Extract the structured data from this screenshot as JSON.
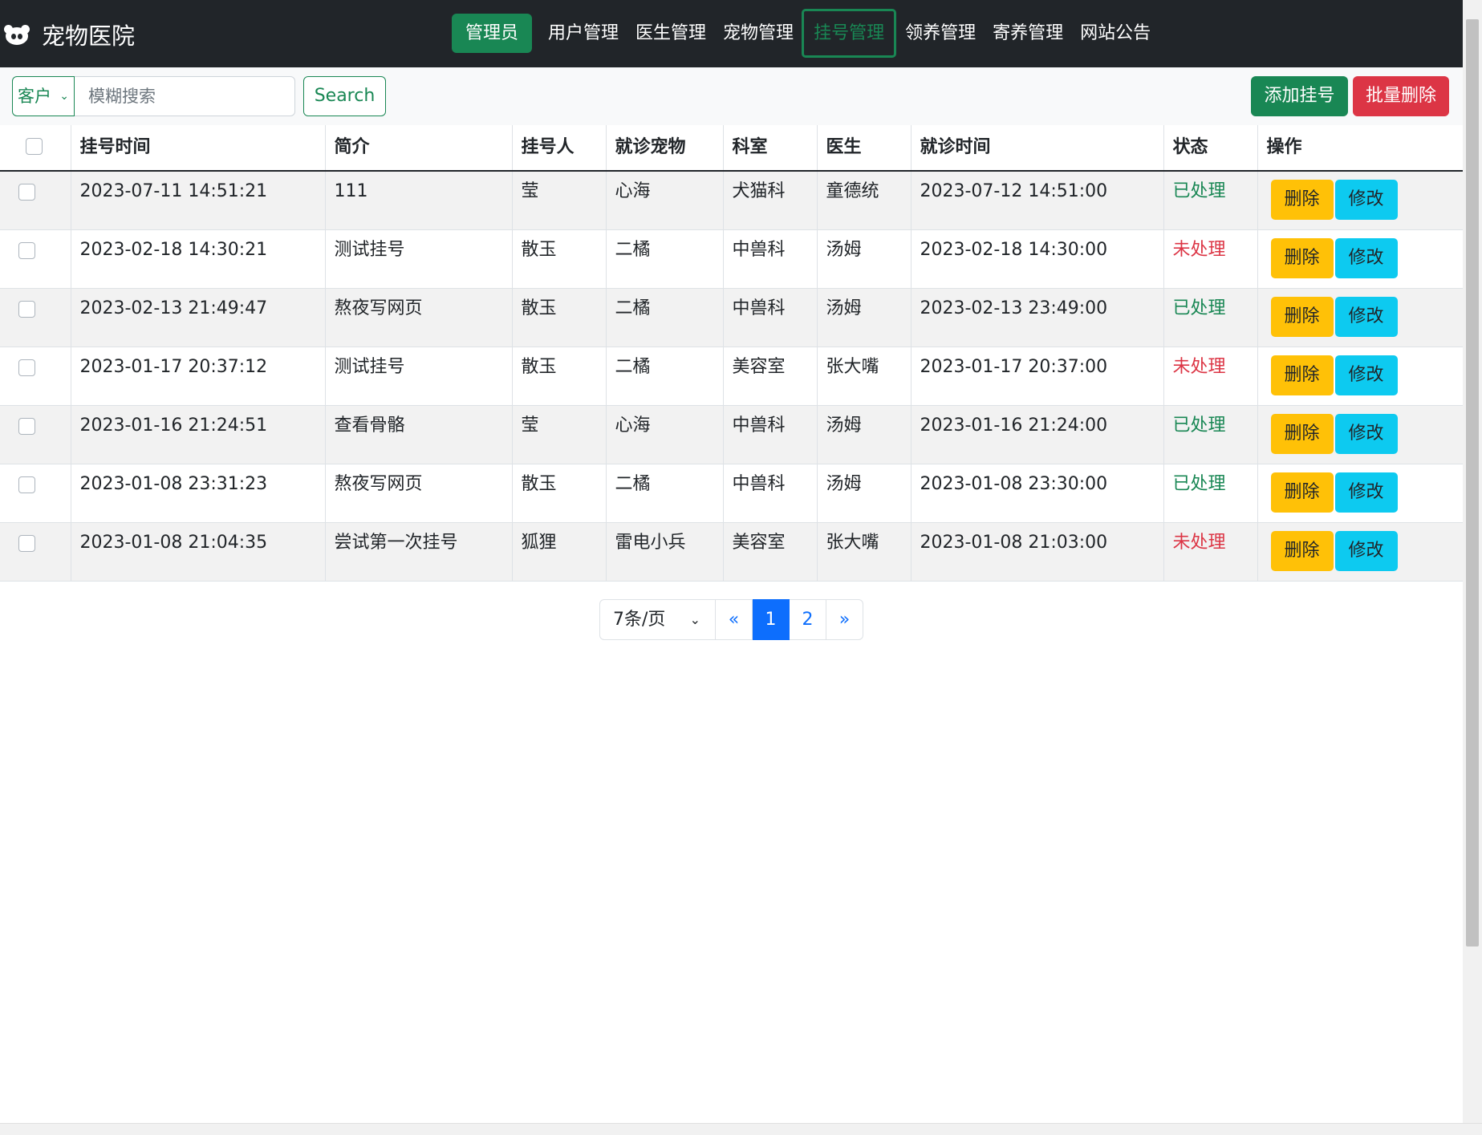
{
  "brand": {
    "title": "宠物医院",
    "logo_icon": "panda-icon"
  },
  "nav": {
    "admin": "管理员",
    "items": [
      "用户管理",
      "医生管理",
      "宠物管理",
      "挂号管理",
      "领养管理",
      "寄养管理",
      "网站公告"
    ],
    "active": "挂号管理"
  },
  "toolbar": {
    "filter_selected": "客户",
    "search_placeholder": "模糊搜索",
    "search_label": "Search",
    "add_label": "添加挂号",
    "bulk_delete_label": "批量删除"
  },
  "table": {
    "headers": [
      "挂号时间",
      "简介",
      "挂号人",
      "就诊宠物",
      "科室",
      "医生",
      "就诊时间",
      "状态",
      "操作"
    ],
    "delete_label": "删除",
    "edit_label": "修改",
    "rows": [
      [
        "2023-07-11 14:51:21",
        "111",
        "莹",
        "心海",
        "犬猫科",
        "童德统",
        "2023-07-12 14:51:00",
        "已处理"
      ],
      [
        "2023-02-18 14:30:21",
        "测试挂号",
        "散玉",
        "二橘",
        "中兽科",
        "汤姆",
        "2023-02-18 14:30:00",
        "未处理"
      ],
      [
        "2023-02-13 21:49:47",
        "熬夜写网页",
        "散玉",
        "二橘",
        "中兽科",
        "汤姆",
        "2023-02-13 23:49:00",
        "已处理"
      ],
      [
        "2023-01-17 20:37:12",
        "测试挂号",
        "散玉",
        "二橘",
        "美容室",
        "张大嘴",
        "2023-01-17 20:37:00",
        "未处理"
      ],
      [
        "2023-01-16 21:24:51",
        "查看骨骼",
        "莹",
        "心海",
        "中兽科",
        "汤姆",
        "2023-01-16 21:24:00",
        "已处理"
      ],
      [
        "2023-01-08 23:31:23",
        "熬夜写网页",
        "散玉",
        "二橘",
        "中兽科",
        "汤姆",
        "2023-01-08 23:30:00",
        "已处理"
      ],
      [
        "2023-01-08 21:04:35",
        "尝试第一次挂号",
        "狐狸",
        "雷电小兵",
        "美容室",
        "张大嘴",
        "2023-01-08 21:03:00",
        "未处理"
      ]
    ]
  },
  "pagination": {
    "per_page": "7条/页",
    "prev": "«",
    "pages": [
      "1",
      "2"
    ],
    "current": "1",
    "next": "»"
  },
  "colors": {
    "navbar": "#212529",
    "success": "#198754",
    "danger": "#dc3545",
    "warning": "#ffc107",
    "info": "#0dcaf0",
    "primary": "#0d6efd"
  }
}
